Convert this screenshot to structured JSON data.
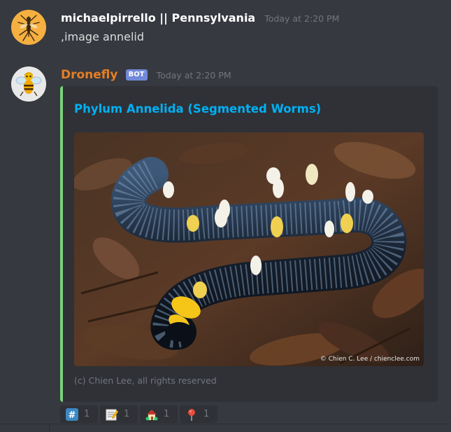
{
  "messages": [
    {
      "username": "michaelpirrello || Pennsylvania",
      "username_color": "#ffffff",
      "timestamp": "Today at 2:20 PM",
      "text": ",image annelid",
      "avatar_icon": "mosquito-icon"
    },
    {
      "username": "Dronefly",
      "username_color": "#e67e22",
      "bot_tag": "BOT",
      "timestamp": "Today at 2:20 PM",
      "avatar_icon": "bee-drone-icon",
      "embed": {
        "accent_color": "#7ad27a",
        "title": "Phylum Annelida (Segmented Worms)",
        "title_color": "#00b0f4",
        "image_description_icon": "segmented-worm-photo",
        "image_watermark": "© Chien C. Lee / chienclee.com",
        "footer": "(c) Chien Lee, all rights reserved"
      }
    }
  ],
  "reactions": [
    {
      "emoji": "hash-keycap-icon",
      "count": "1"
    },
    {
      "emoji": "memo-pencil-icon",
      "count": "1"
    },
    {
      "emoji": "house-garden-icon",
      "count": "1"
    },
    {
      "emoji": "round-pushpin-icon",
      "count": "1"
    }
  ]
}
